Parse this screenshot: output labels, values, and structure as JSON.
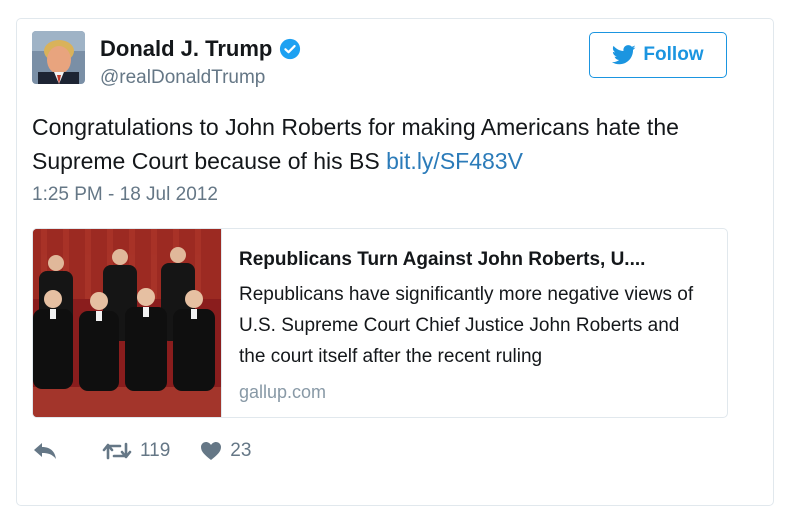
{
  "tweet": {
    "author_name": "Donald J. Trump",
    "handle": "@realDonaldTrump",
    "verified_icon": "verified-badge-icon",
    "follow_label": "Follow",
    "text_before_link": "Congratulations to John Roberts for making Americans hate the Supreme Court because of his BS ",
    "link_text": "bit.ly/SF483V",
    "timestamp": "1:25 PM - 18 Jul 2012"
  },
  "link_card": {
    "title": "Republicans Turn Against John Roberts, U....",
    "description": "Republicans have significantly more negative views of U.S. Supreme Court Chief Justice John Roberts and the court itself after the recent ruling",
    "domain": "gallup.com"
  },
  "actions": {
    "reply_icon": "reply-icon",
    "retweet_icon": "retweet-icon",
    "retweet_count": "119",
    "like_icon": "heart-icon",
    "like_count": "23"
  },
  "colors": {
    "accent": "#1b95e0",
    "link": "#2b7bb9",
    "muted": "#657786",
    "border": "#e1e8ed"
  }
}
